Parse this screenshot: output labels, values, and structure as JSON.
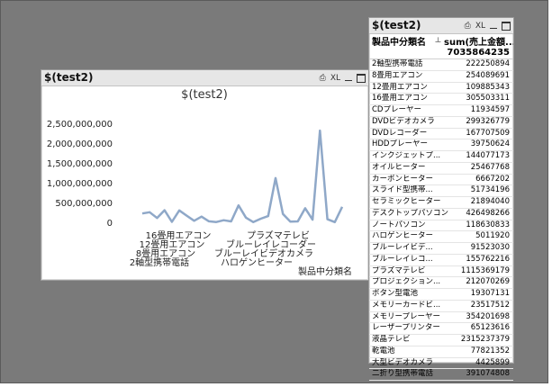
{
  "chart_window": {
    "title": "$(test2)",
    "btn_print": "⎙",
    "btn_xl": "XL",
    "chart_title": "$(test2)"
  },
  "table_window": {
    "title": "$(test2)",
    "btn_print": "⎙",
    "btn_xl": "XL",
    "col_dim": "製品中分類名",
    "col_measure": "sum(売上金額...",
    "total": "7035864235",
    "rows": [
      {
        "name": "2軸型携帯電話",
        "value": "222250894"
      },
      {
        "name": "8畳用エアコン",
        "value": "254089691"
      },
      {
        "name": "12畳用エアコン",
        "value": "109885343"
      },
      {
        "name": "16畳用エアコン",
        "value": "305503311"
      },
      {
        "name": "CDプレーヤー",
        "value": "11934597"
      },
      {
        "name": "DVDビデオカメラ",
        "value": "299326779"
      },
      {
        "name": "DVDレコーダー",
        "value": "167707509"
      },
      {
        "name": "HDDプレーヤー",
        "value": "39750624"
      },
      {
        "name": "インクジェットプ...",
        "value": "144077173"
      },
      {
        "name": "オイルヒーター",
        "value": "25467768"
      },
      {
        "name": "カーボンヒーター",
        "value": "6667202"
      },
      {
        "name": "スライド型携帯...",
        "value": "51734196"
      },
      {
        "name": "セラミックヒーター",
        "value": "21894040"
      },
      {
        "name": "デスクトップパソコン",
        "value": "426498266"
      },
      {
        "name": "ノートパソコン",
        "value": "118630833"
      },
      {
        "name": "ハロゲンヒーター",
        "value": "5011920"
      },
      {
        "name": "ブルーレイビデ...",
        "value": "91523030"
      },
      {
        "name": "ブルーレイレコ...",
        "value": "155762216"
      },
      {
        "name": "プラズマテレビ",
        "value": "1115369179"
      },
      {
        "name": "プロジェクション...",
        "value": "212070269"
      },
      {
        "name": "ボタン型電池",
        "value": "19307131"
      },
      {
        "name": "メモリーカードビ...",
        "value": "23517512"
      },
      {
        "name": "メモリープレーヤー",
        "value": "354201698"
      },
      {
        "name": "レーザープリンター",
        "value": "65123616"
      },
      {
        "name": "液晶テレビ",
        "value": "2315237379"
      },
      {
        "name": "乾電池",
        "value": "77821352"
      },
      {
        "name": "大型ビデオカメラ",
        "value": "4425899"
      },
      {
        "name": "二折り型携帯電話",
        "value": "391074808"
      }
    ]
  },
  "chart_data": {
    "type": "line",
    "title": "$(test2)",
    "xlabel": "製品中分類名",
    "ylabel": "",
    "ylim": [
      0,
      2500000000
    ],
    "yticks": [
      "2,500,000,000",
      "2,000,000,000",
      "1,500,000,000",
      "1,000,000,000",
      "500,000,000",
      "0"
    ],
    "ytick_values": [
      2500000000,
      2000000000,
      1500000000,
      1000000000,
      500000000,
      0
    ],
    "visible_category_labels": [
      {
        "index": 3,
        "text": "16畳用エアコン"
      },
      {
        "index": 2,
        "text": "12畳用エアコン"
      },
      {
        "index": 1,
        "text": "8畳用エアコン"
      },
      {
        "index": 0,
        "text": "2軸型携帯電話"
      },
      {
        "index": 18,
        "text": "プラズマテレビ"
      },
      {
        "index": 17,
        "text": "ブルーレイレコーダー"
      },
      {
        "index": 16,
        "text": "ブルーレイビデオカメラ"
      },
      {
        "index": 15,
        "text": "ハロゲンヒーター"
      }
    ],
    "line_color": "#8fa8c8",
    "values": [
      222250894,
      254089691,
      109885343,
      305503311,
      11934597,
      299326779,
      167707509,
      39750624,
      144077173,
      25467768,
      6667202,
      51734196,
      21894040,
      426498266,
      118630833,
      5011920,
      91523030,
      155762216,
      1115369179,
      212070269,
      19307131,
      23517512,
      354201698,
      65123616,
      2315237379,
      77821352,
      4425899,
      391074808
    ]
  }
}
